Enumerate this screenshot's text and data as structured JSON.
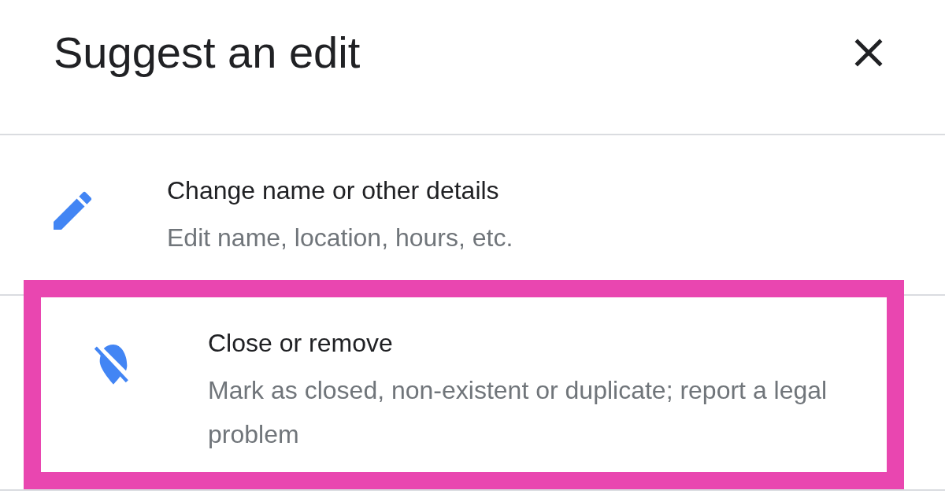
{
  "title": "Suggest an edit",
  "items": [
    {
      "kind": "edit",
      "title": "Change name or other details",
      "description": "Edit name, location, hours, etc.",
      "highlighted": false
    },
    {
      "kind": "remove",
      "title": "Close or remove",
      "description": "Mark as closed, non-existent or duplicate; report a legal problem",
      "highlighted": true
    }
  ]
}
